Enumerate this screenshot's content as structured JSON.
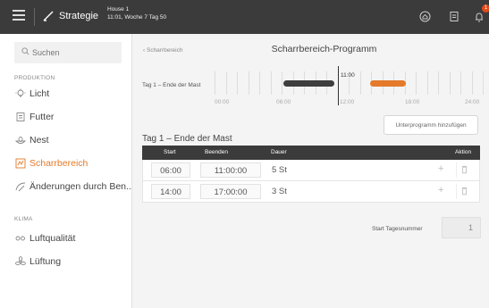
{
  "topbar": {
    "app_title": "Strategie",
    "house": "House 1",
    "house_info": "11:01, Woche 7 Tag 50",
    "badge_count": "1"
  },
  "sidebar": {
    "search_placeholder": "Suchen",
    "sections": [
      {
        "label": "PRODUKTION",
        "items": [
          {
            "label": "Licht",
            "icon": "light-bulb-icon"
          },
          {
            "label": "Futter",
            "icon": "feed-icon"
          },
          {
            "label": "Nest",
            "icon": "nest-icon"
          },
          {
            "label": "Scharrbereich",
            "icon": "scratch-area-icon",
            "active": true
          },
          {
            "label": "Änderungen durch Ben...",
            "icon": "changes-icon"
          }
        ]
      },
      {
        "label": "KLIMA",
        "items": [
          {
            "label": "Luftqualität",
            "icon": "air-quality-icon"
          },
          {
            "label": "Lüftung",
            "icon": "fan-icon"
          }
        ]
      }
    ]
  },
  "main": {
    "back_label": "Scharrbereich",
    "title": "Scharrbereich-Programm",
    "timeline": {
      "label": "Tag 1 – Ende der Mast",
      "now_label": "11:00",
      "hours": [
        "00:00",
        "06:00",
        "12:00",
        "18:00",
        "24:00"
      ]
    },
    "add_button": "Unterprogramm hinzufügen",
    "table": {
      "title": "Tag 1 – Ende der Mast",
      "headers": {
        "start": "Start",
        "end": "Beenden",
        "duration": "Dauer",
        "action": "Aktion"
      },
      "rows": [
        {
          "start": "06:00",
          "end": "11:00:00",
          "duration": "5 St"
        },
        {
          "start": "14:00",
          "end": "17:00:00",
          "duration": "3 St"
        }
      ]
    },
    "start_day_label": "Start Tagesnummer",
    "start_day_value": "1"
  },
  "colors": {
    "topbar": "#3b3b3b",
    "accent": "#e47a2a",
    "badge": "#e24a1c"
  }
}
